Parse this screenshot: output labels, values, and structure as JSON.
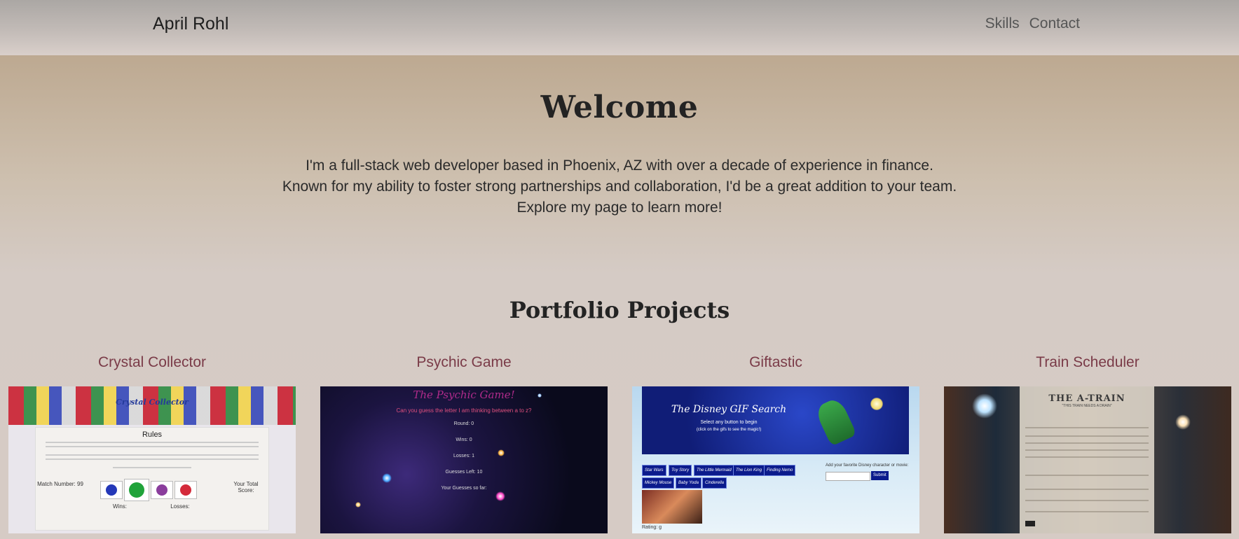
{
  "navbar": {
    "brand": "April Rohl",
    "links": [
      "Skills",
      "Contact"
    ]
  },
  "welcome": {
    "title": "Welcome",
    "lines": [
      "I'm a full-stack web developer based in Phoenix, AZ with over a decade of experience in finance.",
      "Known for my ability to foster strong partnerships and collaboration, I'd be a great addition to your team.",
      "Explore my page to learn more!"
    ]
  },
  "portfolio": {
    "title": "Portfolio Projects",
    "projects": [
      {
        "title": "Crystal Collector",
        "screenshot": {
          "heading": "Crystal Collector",
          "rules": "Rules",
          "match_label": "Match Number: 99",
          "score_label": "Your Total Score:",
          "wins": "Wins:",
          "losses": "Losses:"
        }
      },
      {
        "title": "Psychic Game",
        "screenshot": {
          "heading": "The Psychic Game!",
          "question": "Can you guess the letter I am thinking between a to z?",
          "lines": [
            "Round: 0",
            "Wins: 0",
            "Losses: 1",
            "Guesses Left: 10",
            "Your Guesses so far:"
          ]
        }
      },
      {
        "title": "Giftastic",
        "screenshot": {
          "heading": "The Disney GIF Search",
          "sub1": "Select any button to begin",
          "sub2": "(click on the gifs to see the magic!)",
          "buttons": [
            "Star Wars",
            "Toy Story",
            "The Little Mermaid",
            "The Lion King",
            "Finding Nemo",
            "Mickey Mouse",
            "Baby Yoda",
            "Cinderella"
          ],
          "add_label": "Add your favorite Disney character or movie:",
          "submit": "Submit",
          "rating": "Rating: g"
        }
      },
      {
        "title": "Train Scheduler",
        "screenshot": {
          "heading": "THE A-TRAIN",
          "tagline": "\"THIS TRAIN NEEDS A DRAIN\""
        }
      }
    ]
  },
  "colors": {
    "project_title": "#7a3b48",
    "heading": "#232323",
    "navbar_link": "#555555"
  }
}
